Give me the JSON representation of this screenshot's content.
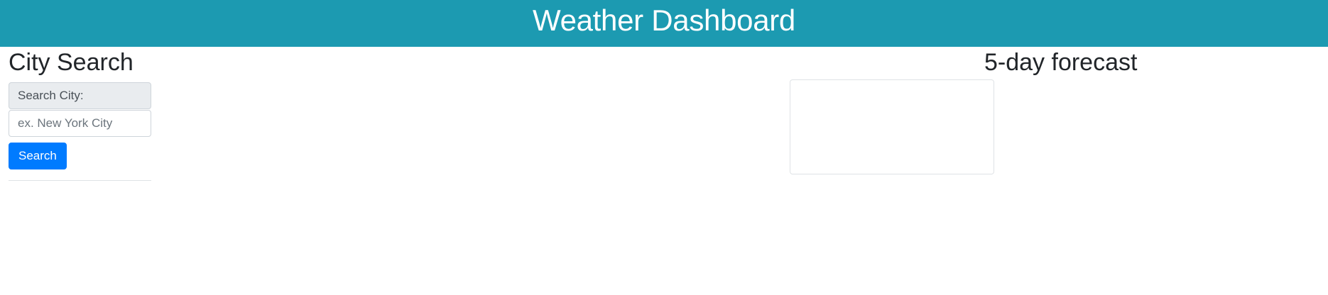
{
  "header": {
    "title": "Weather Dashboard"
  },
  "colors": {
    "header_bg": "#1c9ab1",
    "button_bg": "#007bff"
  },
  "city_search": {
    "title": "City Search",
    "label": "Search City:",
    "input_placeholder": "ex. New York City",
    "input_value": "",
    "button_label": "Search"
  },
  "forecast": {
    "title": "5-day forecast"
  }
}
